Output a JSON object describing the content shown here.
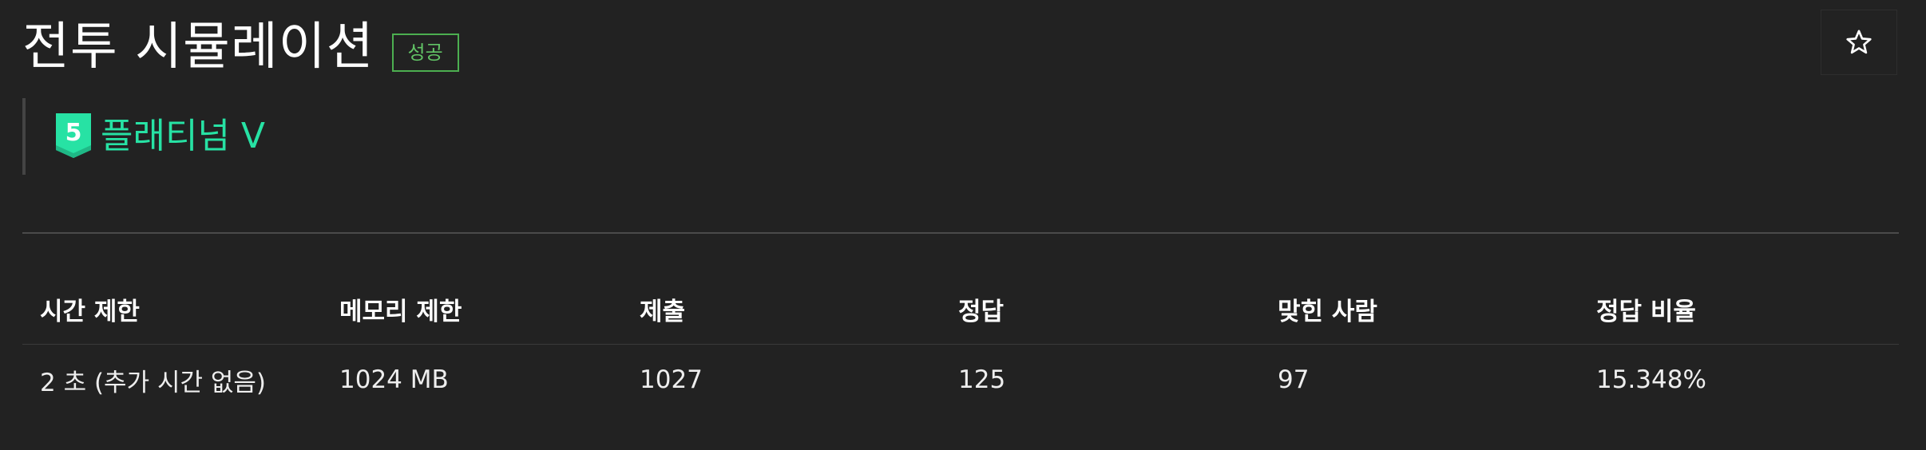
{
  "problem": {
    "title": "전투 시뮬레이션",
    "status_badge": "성공",
    "tier": {
      "number": "5",
      "name": "플래티넘 V",
      "color": "#27e2a4"
    },
    "star_icon": "star-outline-icon"
  },
  "info_table": {
    "headers": [
      "시간 제한",
      "메모리 제한",
      "제출",
      "정답",
      "맞힌 사람",
      "정답 비율"
    ],
    "values": [
      "2 초 (추가 시간 없음)",
      "1024 MB",
      "1027",
      "125",
      "97",
      "15.348%"
    ]
  },
  "colors": {
    "background": "#222222",
    "success": "#4caf50",
    "tier": "#27e2a4"
  }
}
